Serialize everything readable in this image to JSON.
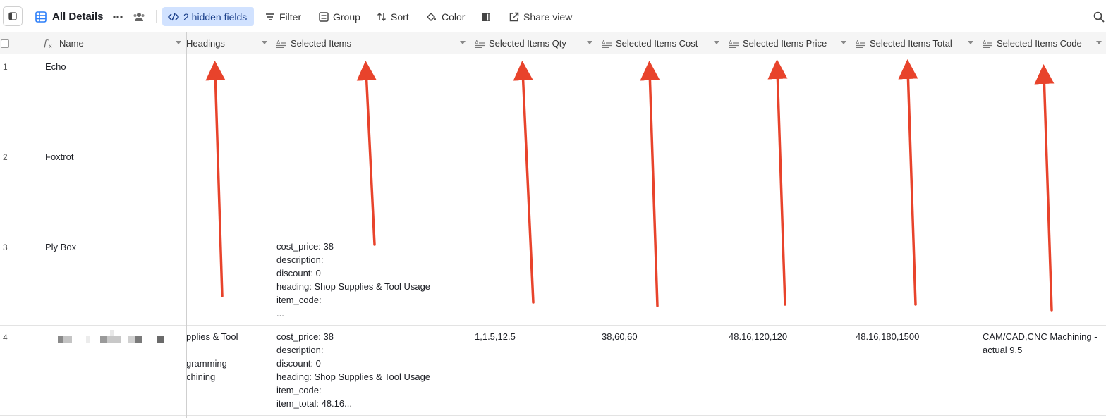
{
  "toolbar": {
    "view_name": "All Details",
    "hidden_fields": "2 hidden fields",
    "filter": "Filter",
    "group": "Group",
    "sort": "Sort",
    "color": "Color",
    "share": "Share view",
    "icons": [
      "sidebar-toggle-icon",
      "grid-view-icon",
      "more-icon",
      "collaborators-icon",
      "hidden-fields-icon",
      "filter-icon",
      "group-icon",
      "sort-icon",
      "color-icon",
      "row-height-icon",
      "share-icon",
      "search-icon"
    ]
  },
  "columns": {
    "name": "Name",
    "headings": "Headings",
    "selected_items": "Selected Items",
    "qty": "Selected Items Qty",
    "cost": "Selected Items Cost",
    "price": "Selected Items Price",
    "total": "Selected Items Total",
    "code": "Selected Items Code"
  },
  "rows": [
    {
      "num": "1",
      "name": "Echo"
    },
    {
      "num": "2",
      "name": "Foxtrot"
    },
    {
      "num": "3",
      "name": "Ply Box",
      "selected_items": [
        "cost_price: 38",
        "description:",
        "discount: 0",
        "heading: Shop Supplies & Tool Usage",
        "item_code:",
        "..."
      ]
    },
    {
      "num": "4",
      "headings": [
        "pplies & Tool",
        "",
        "gramming",
        "chining"
      ],
      "selected_items": [
        "cost_price: 38",
        "description:",
        "discount: 0",
        "heading: Shop Supplies & Tool Usage",
        "item_code:",
        "item_total: 48.16..."
      ],
      "qty": "1,1.5,12.5",
      "cost": "38,60,60",
      "price": "48.16,120,120",
      "total": "48.16,180,1500",
      "code": [
        "CAM/CAD,CNC Machining -",
        "actual 9.5"
      ]
    }
  ],
  "colors": {
    "accent": "#2d7ff9",
    "hidden_fields_bg": "#d1e2ff",
    "arrow": "#e8432b",
    "header_bg": "#f5f5f5"
  }
}
